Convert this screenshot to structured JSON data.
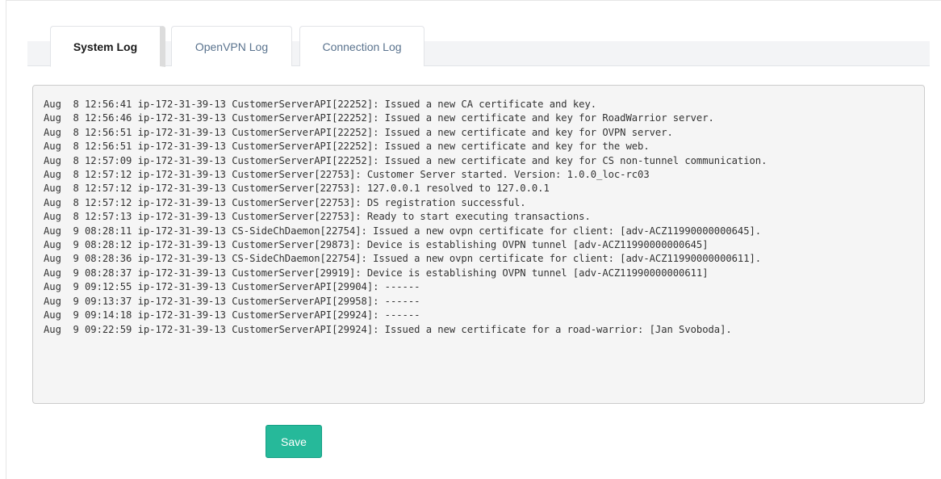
{
  "tabs": [
    {
      "label": "System Log",
      "active": true
    },
    {
      "label": "OpenVPN Log",
      "active": false
    },
    {
      "label": "Connection Log",
      "active": false
    }
  ],
  "log_lines": [
    "Aug  8 12:56:41 ip-172-31-39-13 CustomerServerAPI[22252]: Issued a new CA certificate and key.",
    "Aug  8 12:56:46 ip-172-31-39-13 CustomerServerAPI[22252]: Issued a new certificate and key for RoadWarrior server.",
    "Aug  8 12:56:51 ip-172-31-39-13 CustomerServerAPI[22252]: Issued a new certificate and key for OVPN server.",
    "Aug  8 12:56:51 ip-172-31-39-13 CustomerServerAPI[22252]: Issued a new certificate and key for the web.",
    "Aug  8 12:57:09 ip-172-31-39-13 CustomerServerAPI[22252]: Issued a new certificate and key for CS non-tunnel communication.",
    "Aug  8 12:57:12 ip-172-31-39-13 CustomerServer[22753]: Customer Server started. Version: 1.0.0_loc-rc03",
    "Aug  8 12:57:12 ip-172-31-39-13 CustomerServer[22753]: 127.0.0.1 resolved to 127.0.0.1",
    "Aug  8 12:57:12 ip-172-31-39-13 CustomerServer[22753]: DS registration successful.",
    "Aug  8 12:57:13 ip-172-31-39-13 CustomerServer[22753]: Ready to start executing transactions.",
    "Aug  9 08:28:11 ip-172-31-39-13 CS-SideChDaemon[22754]: Issued a new ovpn certificate for client: [adv-ACZ11990000000645].",
    "Aug  9 08:28:12 ip-172-31-39-13 CustomerServer[29873]: Device is establishing OVPN tunnel [adv-ACZ11990000000645]",
    "Aug  9 08:28:36 ip-172-31-39-13 CS-SideChDaemon[22754]: Issued a new ovpn certificate for client: [adv-ACZ11990000000611].",
    "Aug  9 08:28:37 ip-172-31-39-13 CustomerServer[29919]: Device is establishing OVPN tunnel [adv-ACZ11990000000611]",
    "Aug  9 09:12:55 ip-172-31-39-13 CustomerServerAPI[29904]: ------",
    "Aug  9 09:13:37 ip-172-31-39-13 CustomerServerAPI[29958]: ------",
    "Aug  9 09:14:18 ip-172-31-39-13 CustomerServerAPI[29924]: ------",
    "Aug  9 09:22:59 ip-172-31-39-13 CustomerServerAPI[29924]: Issued a new certificate for a road-warrior: [Jan Svoboda]."
  ],
  "save_label": "Save",
  "colors": {
    "accent": "#26b99a",
    "tab_inactive_text": "#5a738e",
    "log_background": "#f5f5f5"
  }
}
